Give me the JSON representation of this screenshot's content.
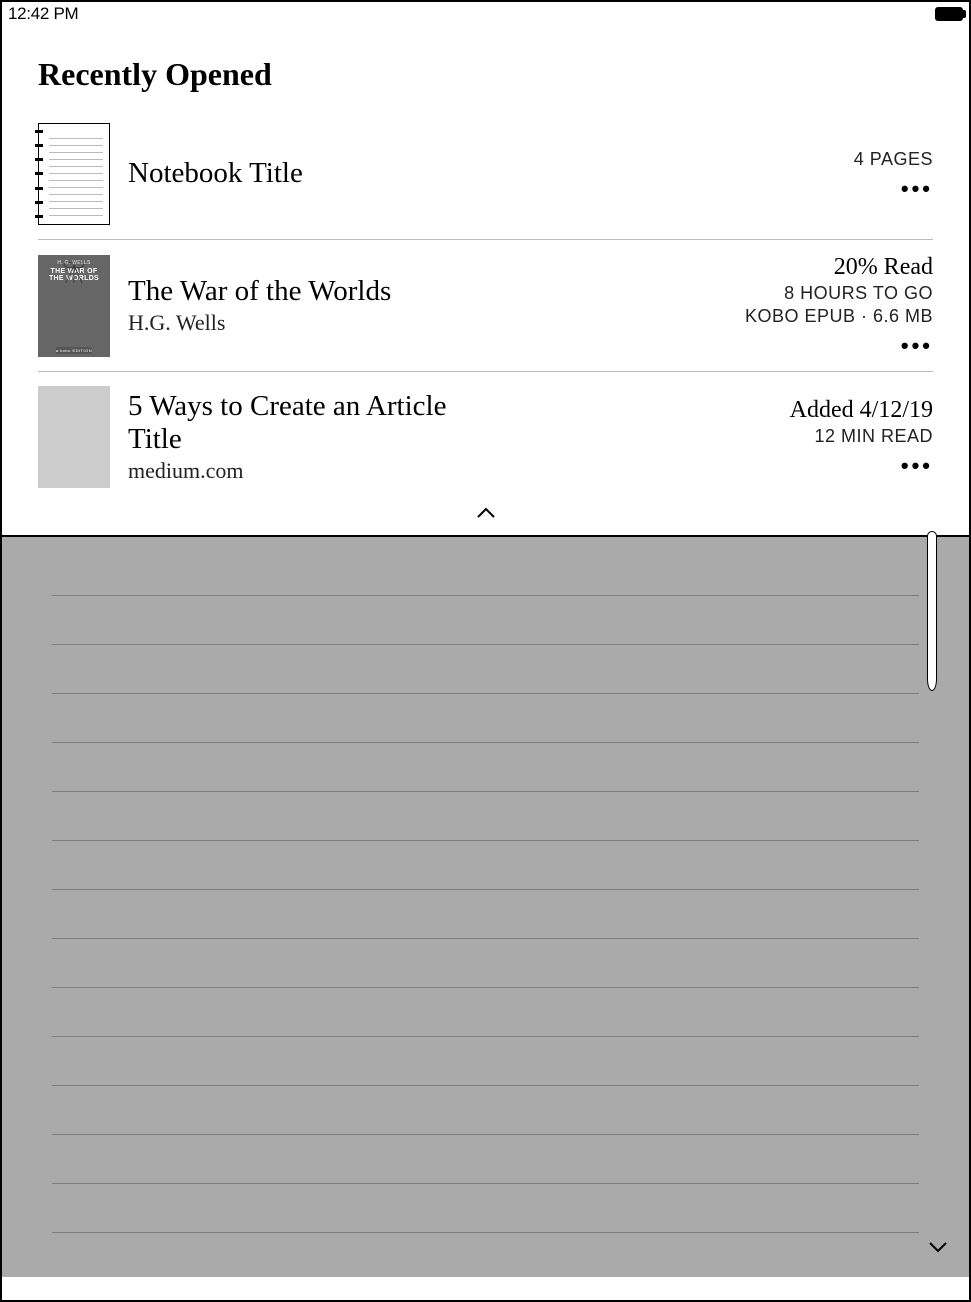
{
  "status": {
    "time": "12:42 PM"
  },
  "section_title": "Recently Opened",
  "items": [
    {
      "title": "Notebook Title",
      "subtitle": "",
      "meta1": "4 PAGES",
      "meta2": "",
      "meta3": ""
    },
    {
      "title": "The War of the Worlds",
      "subtitle": "H.G. Wells",
      "meta1": "20% Read",
      "meta2": "8 HOURS TO GO",
      "meta3": "KOBO EPUB · 6.6 MB",
      "cover_author": "H. G. WELLS",
      "cover_title1": "THE WAR OF",
      "cover_title2": "THE WORLDS",
      "cover_edition": "a kobo EDITION"
    },
    {
      "title": "5 Ways to Create an Article Title",
      "subtitle": "medium.com",
      "meta1": "Added 4/12/19",
      "meta2": "12 MIN READ",
      "meta3": ""
    }
  ]
}
